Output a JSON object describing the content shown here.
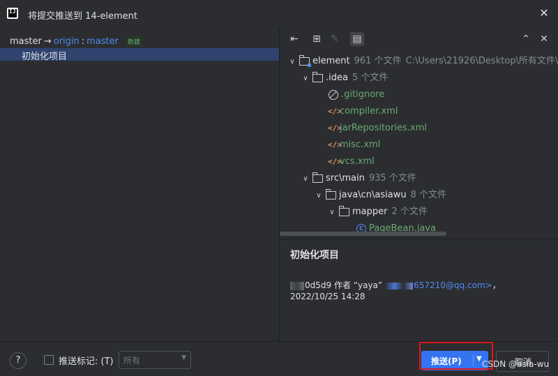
{
  "window": {
    "title": "将提交推送到 14-element",
    "app_icon_text": "IJ"
  },
  "branch": {
    "local": "master",
    "arrow": "→",
    "remote": "origin",
    "separator": ":",
    "remote_branch": "master",
    "badge": "新建"
  },
  "commits": [
    {
      "message": "初始化项目",
      "selected": true
    }
  ],
  "toolbar": {
    "buttons": [
      {
        "name": "expand-diff-icon",
        "glyph": "⇤"
      },
      {
        "name": "group-by-icon",
        "glyph": "⊞"
      },
      {
        "name": "edit-icon",
        "glyph": "✎",
        "disabled": true
      },
      {
        "name": "preview-icon",
        "glyph": "▤",
        "active": true
      },
      {
        "name": "expand-all-icon",
        "glyph": "⌃"
      },
      {
        "name": "collapse-all-icon",
        "glyph": "✕"
      }
    ]
  },
  "tree": [
    {
      "level": 0,
      "type": "module",
      "expanded": true,
      "name": "element",
      "count": "961 个文件",
      "path": "C:\\Users\\21926\\Desktop\\所有文件\\"
    },
    {
      "level": 1,
      "type": "folder",
      "expanded": true,
      "name": ".idea",
      "count": "5 个文件"
    },
    {
      "level": 2,
      "type": "ignore",
      "name": ".gitignore",
      "green": true
    },
    {
      "level": 2,
      "type": "xml",
      "name": "compiler.xml",
      "green": true
    },
    {
      "level": 2,
      "type": "xml",
      "name": "jarRepositories.xml",
      "green": true
    },
    {
      "level": 2,
      "type": "xml",
      "name": "misc.xml",
      "green": true
    },
    {
      "level": 2,
      "type": "xml",
      "name": "vcs.xml",
      "green": true
    },
    {
      "level": 1,
      "type": "folder",
      "expanded": true,
      "name": "src\\main",
      "count": "935 个文件"
    },
    {
      "level": 2,
      "type": "folder",
      "expanded": true,
      "name": "java\\cn\\asiawu",
      "count": "8 个文件"
    },
    {
      "level": 3,
      "type": "folder",
      "expanded": true,
      "name": "mapper",
      "count": "2 个文件"
    },
    {
      "level": 4,
      "type": "class",
      "name": "PageBean.java",
      "green": true
    }
  ],
  "details": {
    "title": "初始化项目",
    "hash": "0d5d9",
    "author_prefix": "作者 “yaya”",
    "email": "657210@qq.com>",
    "email_suffix": "，",
    "date": "2022/10/25 14:28"
  },
  "footer": {
    "help": "?",
    "checkbox_label": "推送标记: (T)",
    "checkbox_checked": false,
    "select_value": "所有",
    "push_label": "推送(P)",
    "cancel_label": "取消",
    "watermark": "CSDN @asia-wu"
  },
  "colors": {
    "accent": "#3574f0",
    "selection": "#2e436e",
    "highlight_box": "#e0171b",
    "new_file_green": "#6aab73"
  }
}
